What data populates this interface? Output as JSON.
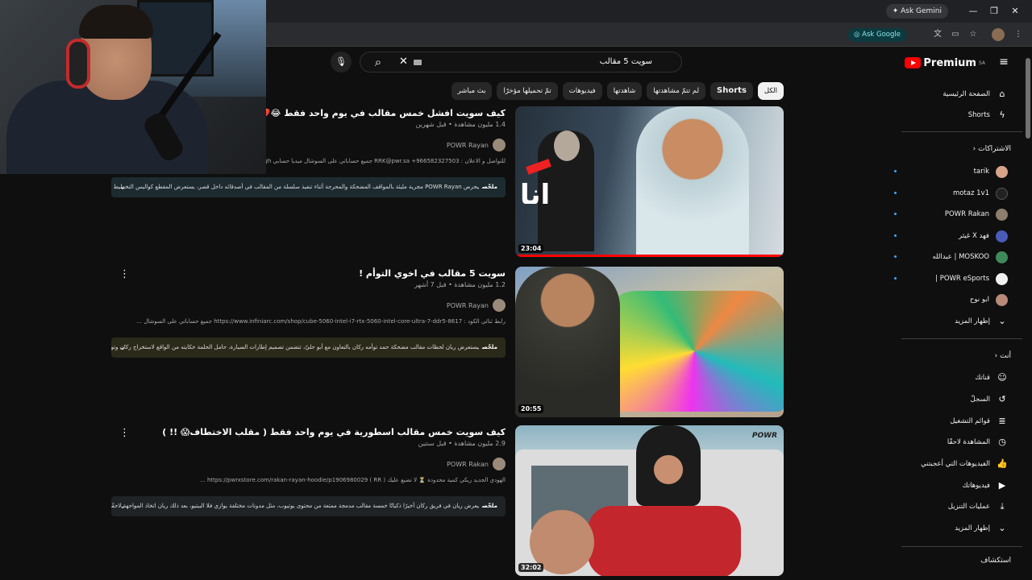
{
  "browser": {
    "ask_gemini": "Ask Gemini",
    "ask_google": "Ask Google"
  },
  "header": {
    "logo_text": "Premium",
    "logo_region": "SA",
    "search_query": "سويت 5 مقالب"
  },
  "chips": [
    {
      "label": "الكل",
      "active": true
    },
    {
      "label": "Shorts",
      "active": false
    },
    {
      "label": "لم تتمّ مشاهدتها",
      "active": false
    },
    {
      "label": "شاهدتها",
      "active": false
    },
    {
      "label": "فيديوهات",
      "active": false
    },
    {
      "label": "تمّ تحميلها مؤخرًا",
      "active": false
    },
    {
      "label": "بث مباشر",
      "active": false
    }
  ],
  "sidebar": {
    "home": "الصفحة الرئيسية",
    "shorts": "Shorts",
    "subscriptions_heading": "الاشتراكات",
    "subscriptions": [
      {
        "name": "tarik",
        "color": "#d8a489"
      },
      {
        "name": "motaz 1v1",
        "color": "#222222"
      },
      {
        "name": "POWR Rakan",
        "color": "#8d7e6d"
      },
      {
        "name": "فهد X غيثر",
        "color": "#4a5bb8"
      },
      {
        "name": "MOSKOO | عبدالله",
        "color": "#3f8a5a"
      },
      {
        "name": "POWR eSports |",
        "color": "#f0f0f0"
      },
      {
        "name": "ابو نوح",
        "color": "#b88a7a"
      }
    ],
    "show_more_1": "إظهار المزيد",
    "you_heading": "أنت",
    "you_items": [
      {
        "label": "قناتك",
        "icon": "person-icon"
      },
      {
        "label": "السجلّ",
        "icon": "history-icon"
      },
      {
        "label": "قوائم التشغيل",
        "icon": "playlist-icon"
      },
      {
        "label": "المشاهدة لاحقًا",
        "icon": "clock-icon"
      },
      {
        "label": "الفيديوهات التي أعجبتني",
        "icon": "like-icon"
      },
      {
        "label": "فيديوهاتك",
        "icon": "video-icon"
      },
      {
        "label": "عمليات التنزيل",
        "icon": "download-icon"
      },
      {
        "label": "إظهار المزيد",
        "icon": "chevron-down-icon"
      }
    ],
    "explore_heading": "استكشاف"
  },
  "videos": [
    {
      "title": "كيف سويت افشل خمس مقالب في يوم واحد فقط 😂💔 !",
      "meta": "1.4 مليون مشاهدة • قبل شهرين",
      "channel": "POWR Rayan",
      "description": "للتواصل و الاعلان : RRK@pwr.sa +966582327503 جميع حساباتي على السوشال ميديا حسابي irayan_gh/",
      "summary_label": "ملخّص",
      "summary": "يحرص POWR Rayan مجرية مليئة بالمواقف المضحكة والمحرجة أثناء تنفيذ سلسلة من المقالب في أصدقائه داخل قصر، يستعرض المقطع كواليس التخطيط لهذه",
      "duration": "23:04",
      "summary_bg": "#1d2b30"
    },
    {
      "title": "سويت 5 مقالب في اخوي التوأم !",
      "meta": "1.2 مليون مشاهدة • قبل 7 أشهر",
      "channel": "POWR Rayan",
      "description": "رابط ثنائي الكود : https://www.infiniarc.com/shop/cube-5060-intel-i7-rtx-5060-intel-core-ultra-7-ddr5-8617 جميع حساباتي على السوشال ...",
      "summary_label": "ملخّص",
      "summary": "يستعرض ريان لحظات مقالب مضحكة حمد توأمه ركان بالتعاون مع أبو حليّ، تتضمن تصميم إطارات السيارة، حامل الحلمة حكايته من الواقع لاستخراج ركان وتوثيق ردّ...",
      "duration": "20:55",
      "summary_bg": "#2b2a1a"
    },
    {
      "title": "كيف سويت خمس مقالب اسطورية في يوم واحد فقط ( مقلب الاختطاف😱 !! )",
      "meta": "2.9 مليون مشاهدة • قبل سنتين",
      "channel": "POWR Rakan",
      "description": "الهودي الجديد ريكي كمية محدودة ⏳ لا تضيع عليك ( RR ) https://pwrxstore.com/rakan-rayan-hoodie/p1906980029 ...",
      "summary_label": "ملخّص",
      "summary": "يعرض ريان في فريق ركان أخيرًا ذكياتًا خمسة مقالب مدمجة ممتعة من محتوى يوتيوب، مثل مدونات مختلفة يوازي فلا البيتيو، بعد ذلك ريان اتخاذ المواجهة لاحقًا أزمان.",
      "duration": "32:02",
      "summary_bg": "#1f2325"
    }
  ]
}
